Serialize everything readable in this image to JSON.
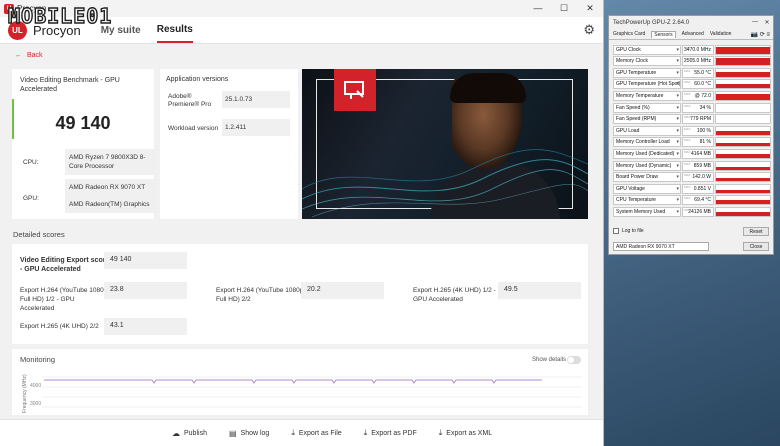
{
  "watermark": "MOBILE01",
  "window": {
    "title": "Procyon",
    "minimize": "—",
    "maximize": "☐",
    "close": "✕"
  },
  "nav": {
    "logo": "UL",
    "brand": "Procyon",
    "tabs": [
      {
        "label": "My suite"
      },
      {
        "label": "Results"
      }
    ]
  },
  "back_label": "Back",
  "score_card": {
    "title": "Video Editing Benchmark - GPU Accelerated",
    "score": "49 140",
    "cpu_label": "CPU:",
    "cpu_value": "AMD Ryzen 7 9800X3D 8-Core Processor",
    "gpu_label": "GPU:",
    "gpu_values": [
      "AMD Radeon RX 9070 XT",
      "AMD Radeon(TM) Graphics"
    ]
  },
  "apps_card": {
    "title": "Application versions",
    "rows": [
      {
        "label": "Adobe® Premiere® Pro",
        "value": "25.1.0.73"
      },
      {
        "label": "Workload version",
        "value": "1.2.411"
      }
    ]
  },
  "detailed": {
    "title": "Detailed scores",
    "main_label": "Video Editing Export score - GPU Accelerated",
    "main_value": "49 140",
    "items": [
      {
        "label": "Export H.264 (YouTube 1080p Full HD) 1/2 - GPU Accelerated",
        "value": "23.8"
      },
      {
        "label": "Export H.264 (YouTube 1080p Full HD) 2/2",
        "value": "20.2"
      },
      {
        "label": "Export H.265 (4K UHD) 1/2 - GPU Accelerated",
        "value": "49.5"
      },
      {
        "label": "Export H.265 (4K UHD) 2/2",
        "value": "43.1"
      }
    ]
  },
  "monitoring": {
    "title": "Monitoring",
    "show_details": "Show details",
    "y_title": "Frequency (MHz)",
    "y_ticks": [
      "4000",
      "3000"
    ]
  },
  "actions": [
    {
      "icon": "☁",
      "label": "Publish"
    },
    {
      "icon": "▤",
      "label": "Show log"
    },
    {
      "icon": "⤓",
      "label": "Export as File"
    },
    {
      "icon": "⤓",
      "label": "Export as PDF"
    },
    {
      "icon": "⤓",
      "label": "Export as XML"
    }
  ],
  "gpuz": {
    "title": "TechPowerUp GPU-Z 2.64.0",
    "tabs": [
      "Graphics Card",
      "Sensors",
      "Advanced",
      "Validation"
    ],
    "active_tab": "Sensors",
    "sensors": [
      {
        "label": "GPU Clock",
        "value": "3470.0 MHz",
        "level": 0.8
      },
      {
        "label": "Memory Clock",
        "value": "2505.0 MHz",
        "level": 0.85
      },
      {
        "label": "GPU Temperature",
        "value": "55.0 °C",
        "level": 0.55
      },
      {
        "label": "GPU Temperature (Hot Spot)",
        "value": "60.0 °C",
        "level": 0.6
      },
      {
        "label": "Memory Temperature",
        "value": "@ 72.0",
        "level": 0.7
      },
      {
        "label": "Fan Speed (%)",
        "value": "34 %",
        "level": 0.0
      },
      {
        "label": "Fan Speed (RPM)",
        "value": "779 RPM",
        "level": 0.0
      },
      {
        "label": "GPU Load",
        "value": "100 %",
        "level": 0.5
      },
      {
        "label": "Memory Controller Load",
        "value": "81 %",
        "level": 0.4
      },
      {
        "label": "Memory Used (Dedicated)",
        "value": "4164 MB",
        "level": 0.45
      },
      {
        "label": "Memory Used (Dynamic)",
        "value": "859 MB",
        "level": 0.35
      },
      {
        "label": "Board Power Draw",
        "value": "142.0 W",
        "level": 0.4
      },
      {
        "label": "GPU Voltage",
        "value": "0.851 V",
        "level": 0.3
      },
      {
        "label": "CPU Temperature",
        "value": "69.4 °C",
        "level": 0.5
      },
      {
        "label": "System Memory Used",
        "value": "24126 MB",
        "level": 0.55
      }
    ],
    "log_label": "Log to file",
    "reset_label": "Reset",
    "device": "AMD Radeon RX 9070 XT",
    "close_label": "Close"
  }
}
